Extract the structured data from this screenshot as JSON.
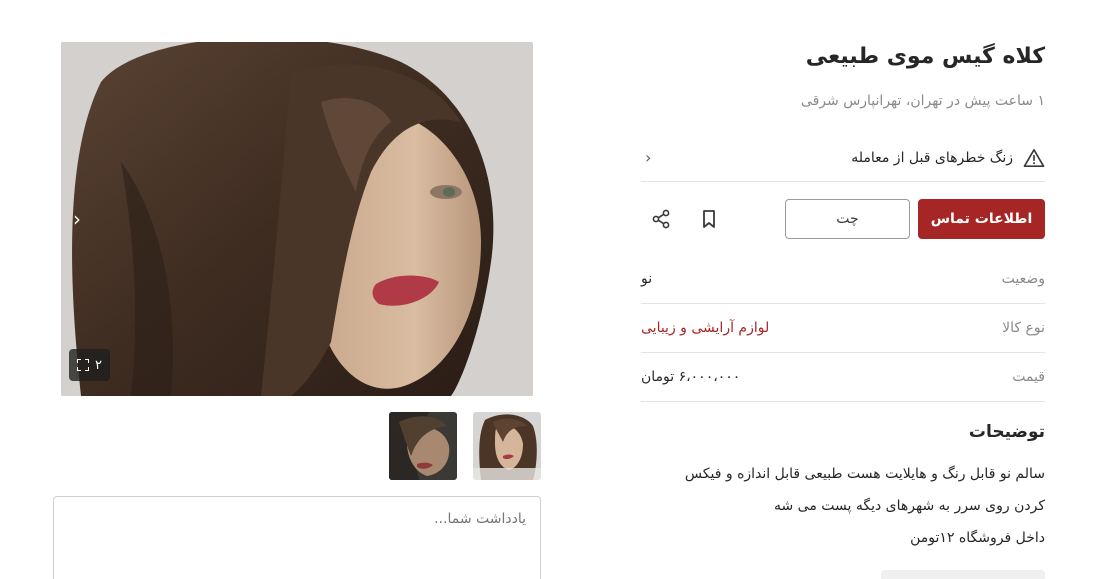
{
  "listing": {
    "title": "کلاه گیس موی طبیعی",
    "subtitle": "۱ ساعت پیش در تهران، تهرانپارس شرقی"
  },
  "alert": {
    "text": "زنگ خطرهای قبل از معامله",
    "icon": "warning-triangle-icon"
  },
  "actions": {
    "contact_label": "اطلاعات تماس",
    "chat_label": "چت",
    "bookmark_icon": "bookmark-icon",
    "share_icon": "share-icon",
    "accent_color": "#a62626"
  },
  "details": [
    {
      "label": "وضعیت",
      "value": "نو"
    },
    {
      "label": "نوع کالا",
      "value": "لوازم آرایشی و زیبایی"
    },
    {
      "label": "قیمت",
      "value": "۶،۰۰۰،۰۰۰ تومان"
    }
  ],
  "description": {
    "title": "توضیحات",
    "lines": [
      "سالم نو قابل رنگ و هایلایت هست طبیعی قابل اندازه و فیکس",
      "کردن روی سرر به شهرهای دیگه پست می شه",
      "داخل فروشگاه ۱۲تومن"
    ]
  },
  "gallery": {
    "image_count": "۲",
    "prev_icon": "chevron-right-icon",
    "expand_icon": "expand-icon"
  },
  "note": {
    "placeholder": "یادداشت شما..."
  }
}
